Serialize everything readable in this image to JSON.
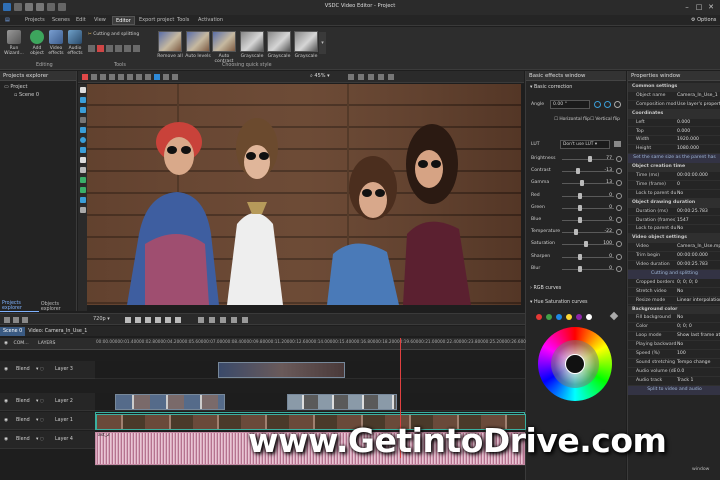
{
  "window": {
    "title": "VSDC Video Editor - Project"
  },
  "menu": {
    "items": [
      "Projects",
      "Scenes",
      "Edit",
      "View",
      "Editor",
      "Export project",
      "Tools",
      "Activation"
    ],
    "active": "Editor",
    "options": "Options"
  },
  "ribbon": {
    "run_wizard": "Run Wizard...",
    "add_object": "Add object",
    "video_effects": "Video effects",
    "audio_effects": "Audio effects",
    "editing_label": "Editing",
    "cutting": "Cutting and splitting",
    "tools_label": "Tools",
    "quick_styles": [
      "Remove all",
      "Auto levels",
      "Auto contrast",
      "Grayscale",
      "Grayscale",
      "Grayscale"
    ],
    "quick_style_label": "Choosing quick style"
  },
  "projects_explorer": {
    "title": "Projects explorer",
    "project": "Project",
    "scene": "Scene 0",
    "tabs": [
      "Projects explorer",
      "Objects explorer"
    ]
  },
  "canvas_toolbar": {
    "zoom": "45%"
  },
  "effects": {
    "title": "Basic effects window",
    "basic_correction": "Basic correction",
    "angle_label": "Angle",
    "angle_value": "0.00 °",
    "hflip": "Horizontal flip",
    "vflip": "Vertical flip",
    "lut_label": "LUT",
    "lut_value": "Don't use LUT",
    "sliders": [
      {
        "label": "Brightness",
        "value": "77",
        "pos": 0.78
      },
      {
        "label": "Contrast",
        "value": "-13",
        "pos": 0.45
      },
      {
        "label": "Gamma",
        "value": "13",
        "pos": 0.56
      },
      {
        "label": "Red",
        "value": "0",
        "pos": 0.5
      },
      {
        "label": "Green",
        "value": "0",
        "pos": 0.5
      },
      {
        "label": "Blue",
        "value": "0",
        "pos": 0.5
      },
      {
        "label": "Temperature",
        "value": "-22",
        "pos": 0.4
      },
      {
        "label": "Saturation",
        "value": "100",
        "pos": 0.68
      },
      {
        "label": "Sharpen",
        "value": "0",
        "pos": 0.5
      },
      {
        "label": "Blur",
        "value": "0",
        "pos": 0.5
      }
    ],
    "rgb_curves": "RGB curves",
    "hue_curves": "Hue Saturation curves",
    "dot_colors": [
      "#e53935",
      "#43a047",
      "#1e88e5",
      "#fdd835",
      "#8e24aa",
      "#ffffff"
    ]
  },
  "properties": {
    "title": "Properties window",
    "rows": [
      {
        "type": "sec",
        "k": "Common settings"
      },
      {
        "k": "Object name",
        "v": "Camera_In_Use_1"
      },
      {
        "k": "Composition mode",
        "v": "Use layer's properties"
      },
      {
        "type": "sec",
        "k": "Coordinates"
      },
      {
        "k": "Left",
        "v": "0.000"
      },
      {
        "k": "Top",
        "v": "0.000"
      },
      {
        "k": "Width",
        "v": "1920.000"
      },
      {
        "k": "Height",
        "v": "1080.000"
      },
      {
        "type": "btn",
        "k": "Set the same size as the parent has"
      },
      {
        "type": "sec",
        "k": "Object creation time"
      },
      {
        "k": "Time (ms)",
        "v": "00:00:00.000"
      },
      {
        "k": "Time (frame)",
        "v": "0"
      },
      {
        "k": "Lock to parent dur.",
        "v": "No"
      },
      {
        "type": "sec",
        "k": "Object drawing duration"
      },
      {
        "k": "Duration (ms)",
        "v": "00:00:25.783"
      },
      {
        "k": "Duration (frames)",
        "v": "1547"
      },
      {
        "k": "Lock to parent dur.",
        "v": "No"
      },
      {
        "type": "sec",
        "k": "Video object settings"
      },
      {
        "k": "Video",
        "v": "Camera_In_Use.mp4"
      },
      {
        "k": "Trim begin",
        "v": "00:00:00.000"
      },
      {
        "k": "Video duration",
        "v": "00:00:25.783"
      },
      {
        "type": "btn",
        "k": "Cutting and splitting"
      },
      {
        "k": "Cropped borders",
        "v": "0; 0; 0; 0"
      },
      {
        "k": "Stretch video",
        "v": "No"
      },
      {
        "k": "Resize mode",
        "v": "Linear interpolation"
      },
      {
        "type": "sec",
        "k": "Background color"
      },
      {
        "k": "Fill background",
        "v": "No"
      },
      {
        "k": "Color",
        "v": "0; 0; 0"
      },
      {
        "k": "Loop mode",
        "v": "Show last frame at the..."
      },
      {
        "k": "Playing backwards",
        "v": "No"
      },
      {
        "k": "Speed (%)",
        "v": "100"
      },
      {
        "k": "Sound stretching mo",
        "v": "Tempo change"
      },
      {
        "k": "Audio volume (dB)",
        "v": "0.0"
      },
      {
        "k": "Audio track",
        "v": "Track 1"
      },
      {
        "type": "btn",
        "k": "Split to video and audio"
      }
    ]
  },
  "timeline": {
    "zoom": "720p",
    "tabs": [
      "Scene 0",
      "Video: Camera_In_Use_1"
    ],
    "ruler": [
      "00:00.000",
      "00:01.400",
      "00:02.800",
      "00:04.200",
      "00:05.600",
      "00:07.000",
      "00:08.400",
      "00:09.800",
      "00:11.200",
      "00:12.600",
      "00:14.000",
      "00:15.400",
      "00:16.800",
      "00:18.200",
      "00:19.600",
      "00:21.000",
      "00:22.400",
      "00:23.800",
      "00:25.200",
      "00:26.600"
    ],
    "header_com": "COM...",
    "header_layers": "LAYERS",
    "tracks": [
      {
        "blend": "Blend",
        "layer": "Layer 3"
      },
      {
        "blend": "Blend",
        "layer": "Layer 2"
      },
      {
        "blend": "Blend",
        "layer": "Layer 1"
      },
      {
        "blend": "Blend",
        "layer": "Layer 4"
      }
    ],
    "clip_label": "ast_2"
  },
  "watermark": "www.GetintoDrive.com",
  "bottom_right": "window"
}
